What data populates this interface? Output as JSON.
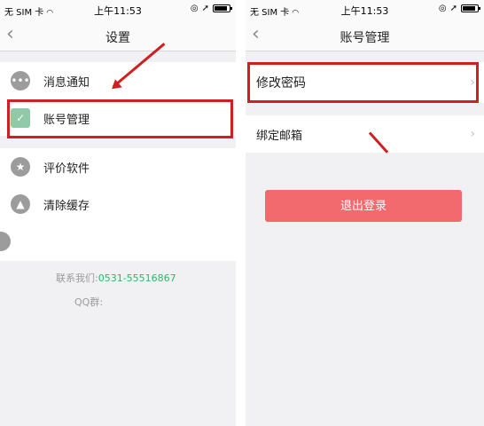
{
  "left": {
    "status": {
      "carrier": "无 SIM 卡",
      "time": "上午11:53",
      "wifi": "wifi-icon"
    },
    "nav": {
      "title": "设置"
    },
    "menu": [
      {
        "label": "消息通知",
        "icon": "message-icon"
      },
      {
        "label": "账号管理",
        "icon": "account-icon"
      },
      {
        "label": "评价软件",
        "icon": "star-icon"
      },
      {
        "label": "清除缓存",
        "icon": "brush-icon"
      }
    ],
    "contact": {
      "prefix": "联系我们:",
      "phone": "0531-55516867",
      "qq_label": "QQ群:"
    }
  },
  "right": {
    "status": {
      "carrier": "无 SIM 卡",
      "time": "上午11:53"
    },
    "nav": {
      "title": "账号管理"
    },
    "items": [
      {
        "label": "修改密码"
      },
      {
        "label": "绑定邮箱"
      }
    ],
    "logout": "退出登录"
  },
  "colors": {
    "highlight": "#d11f1f",
    "logout": "#f26a6e",
    "phone": "#33b36a"
  }
}
